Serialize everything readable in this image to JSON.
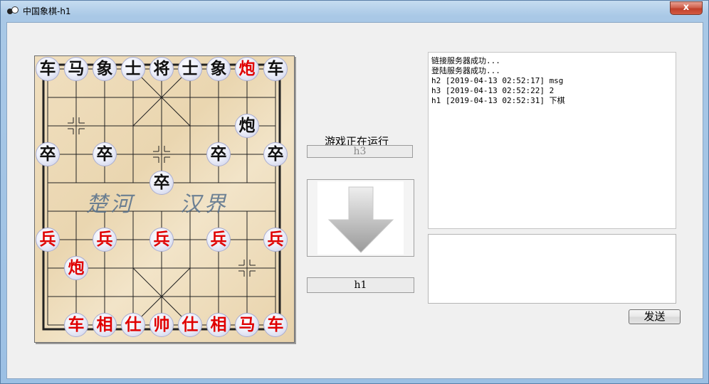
{
  "window": {
    "title": "中国象棋-h1",
    "close_label": "x"
  },
  "board": {
    "river_left": "楚河",
    "river_right": "汉界",
    "black_pieces": [
      "车",
      "马",
      "象",
      "士",
      "将",
      "士",
      "象",
      "车",
      "炮",
      "卒",
      "卒",
      "卒",
      "卒",
      "卒"
    ],
    "red_pieces": [
      "炮",
      "兵",
      "兵",
      "兵",
      "兵",
      "兵",
      "炮",
      "车",
      "相",
      "仕",
      "帅",
      "仕",
      "相",
      "马",
      "车"
    ]
  },
  "status": {
    "text": "游戏正在运行"
  },
  "players": {
    "opponent": "h3",
    "self": "h1"
  },
  "log": {
    "lines": [
      "链接服务器成功...",
      "登陆服务器成功...",
      "h2 [2019-04-13 02:52:17] msg",
      "h3 [2019-04-13 02:52:22] 2",
      "h1 [2019-04-13 02:52:31] 下棋"
    ]
  },
  "chat": {
    "input_value": "",
    "send_label": "发送"
  },
  "icons": {
    "close": "close-icon",
    "arrow": "down-arrow-icon",
    "app": "app-icon"
  }
}
